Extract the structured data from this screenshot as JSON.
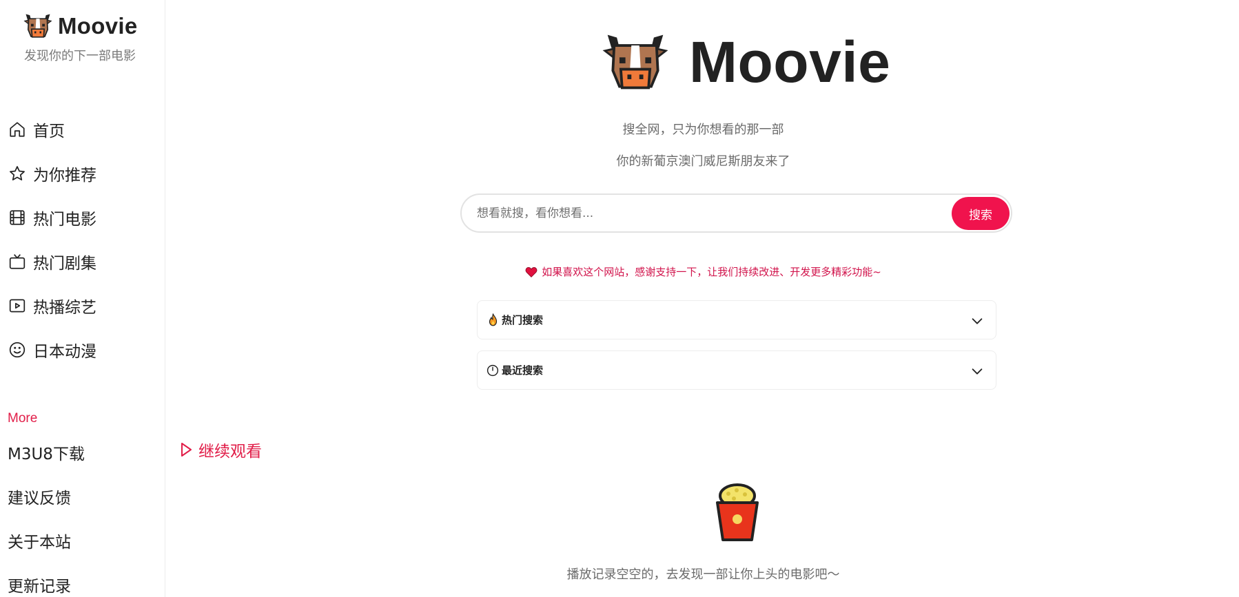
{
  "sidebar": {
    "brand_title": "Moovie",
    "brand_subtitle": "发现你的下一部电影",
    "nav_items": [
      {
        "label": "首页",
        "icon": "home-icon"
      },
      {
        "label": "为你推荐",
        "icon": "star-icon"
      },
      {
        "label": "热门电影",
        "icon": "film-icon"
      },
      {
        "label": "热门剧集",
        "icon": "tv-icon"
      },
      {
        "label": "热播综艺",
        "icon": "play-square-icon"
      },
      {
        "label": "日本动漫",
        "icon": "smile-icon"
      }
    ],
    "more_label": "More",
    "more_items": [
      {
        "label": "M3U8下载"
      },
      {
        "label": "建议反馈"
      },
      {
        "label": "关于本站"
      },
      {
        "label": "更新记录"
      }
    ]
  },
  "hero": {
    "title": "Moovie",
    "slogan_line1": "搜全网，只为你想看的那一部",
    "slogan_line2": "你的新葡京澳门威尼斯朋友来了"
  },
  "search": {
    "placeholder": "想看就搜，看你想看...",
    "value": "",
    "button_label": "搜索"
  },
  "support_message": "如果喜欢这个网站，感谢支持一下，让我们持续改进、开发更多精彩功能~",
  "sections": {
    "hot_search_label": "热门搜索",
    "recent_search_label": "最近搜索"
  },
  "continue_watching": {
    "label": "继续观看",
    "empty_message": "播放记录空空的，去发现一部让你上头的电影吧～"
  },
  "colors": {
    "accent": "#f0134d",
    "accent_text": "#e11d48",
    "text_primary": "#222222",
    "text_muted": "#6b6b6b"
  }
}
